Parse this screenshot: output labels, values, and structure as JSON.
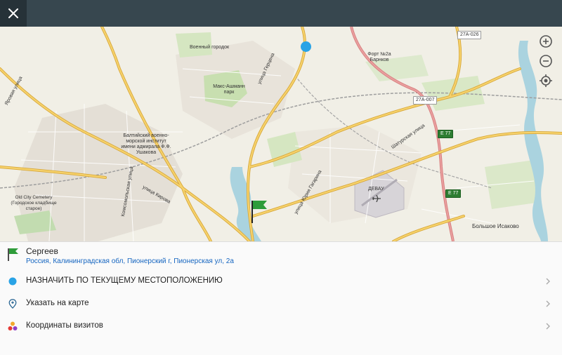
{
  "app": {
    "close_icon": "close-icon"
  },
  "map": {
    "labels": {
      "military_town": "Военный городок",
      "park": "Макс-Ашманн парк",
      "fort": "Форт №2а Барнков",
      "institute": "Балтийский военно-морской институт имени адмирала Ф.Ф. Ушакова",
      "cemetery": "Old City Cemetery (Городское кладбище старое)",
      "airport": "ДЕВАУ",
      "village": "Большое Исаково",
      "street_gerzen": "улица Герцена",
      "street_kirova": "улица Кирова",
      "street_gagarina": "улица Юрия Гагарина",
      "street_shaturskaya": "Шатурская улица",
      "street_komsomolskaya": "Комсомольская улица",
      "street_yarovaya": "Яровая улица"
    },
    "road_badges": {
      "r1": "27А-026",
      "r2": "27А-007",
      "e77a": "E 77",
      "e77b": "E 77"
    },
    "controls": {
      "zoom_in": "zoom-in-icon",
      "zoom_out": "zoom-out-icon",
      "locate": "locate-icon"
    },
    "colors": {
      "background": "#f1efe6",
      "major_road": "#f0c24f",
      "highway": "#d98080",
      "water": "#aad3df",
      "park": "#c8dfb0",
      "marker": "#29a3e6",
      "flag": "#2e9c3a"
    }
  },
  "panel": {
    "name": "Сергеев",
    "address": "Россия, Калининградская обл, Пионерский г, Пионерская ул, 2а",
    "rows": [
      {
        "label": "НАЗНАЧИТЬ ПО ТЕКУЩЕМУ МЕСТОПОЛОЖЕНИЮ",
        "icon": "current-location-dot-icon"
      },
      {
        "label": "Указать на карте",
        "icon": "map-pin-icon"
      },
      {
        "label": "Координаты визитов",
        "icon": "visit-dots-icon"
      }
    ]
  }
}
